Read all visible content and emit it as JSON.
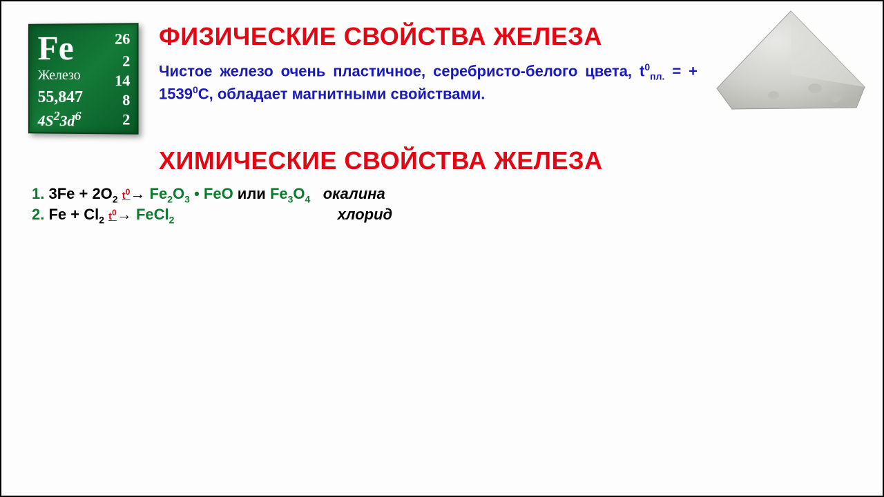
{
  "tile": {
    "symbol": "Fe",
    "name": "Железо",
    "mass": "55,847",
    "config_base": "4S",
    "config_sup1": "2",
    "config_mid": "3d",
    "config_sup2": "6",
    "n1": "26",
    "n2": "2",
    "n3": "14",
    "n4": "8",
    "n5": "2"
  },
  "title1": "ФИЗИЧЕСКИЕ СВОЙСТВА ЖЕЛЕЗА",
  "title2": "ХИМИЧЕСКИЕ СВОЙСТВА ЖЕЛЕЗА",
  "desc_part1": "Чистое железо очень пластичное, серебристо-белого цвета, t",
  "desc_sup": "0",
  "desc_sub": "пл.",
  "desc_part2": " = + 1539",
  "desc_sup2": "0",
  "desc_part3": "С, обладает магнитными свойствами.",
  "eq1": {
    "num": "1. ",
    "a": "3Fe + 2O",
    "a_sub": "2",
    "cond": "t",
    "cond_sup": "0",
    "arr": "→",
    "b1": " Fe",
    "b1s1": "2",
    "b1m": "O",
    "b1s2": "3",
    "dot": " • ",
    "b2": "FeO",
    "or": " или ",
    "b3": "Fe",
    "b3s1": "3",
    "b3m": "O",
    "b3s2": "4",
    "label": "окалина"
  },
  "eq2": {
    "num": "2. ",
    "a": "Fe + Cl",
    "a_sub": "2",
    "cond": "t",
    "cond_sup": "0",
    "arr": "→",
    "b": " FeCl",
    "b_sub": "2",
    "label": "хлорид"
  }
}
